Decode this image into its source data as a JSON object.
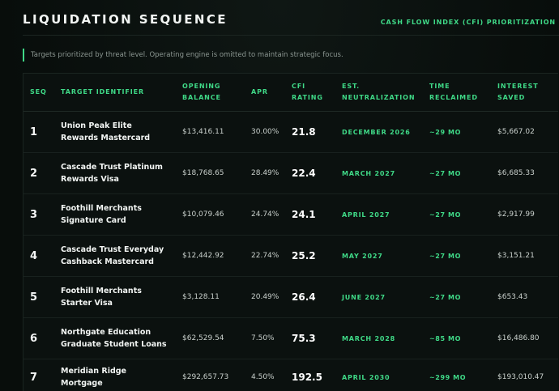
{
  "header": {
    "title": "LIQUIDATION SEQUENCE",
    "subtitle": "CASH FLOW INDEX (CFI) PRIORITIZATION"
  },
  "note": "Targets prioritized by threat level. Operating engine is omitted to maintain strategic focus.",
  "table": {
    "columns": [
      {
        "line1": "SEQ",
        "line2": ""
      },
      {
        "line1": "TARGET IDENTIFIER",
        "line2": ""
      },
      {
        "line1": "OPENING",
        "line2": "BALANCE"
      },
      {
        "line1": "APR",
        "line2": ""
      },
      {
        "line1": "CFI",
        "line2": "RATING"
      },
      {
        "line1": "EST.",
        "line2": "NEUTRALIZATION"
      },
      {
        "line1": "TIME",
        "line2": "RECLAIMED"
      },
      {
        "line1": "INTEREST",
        "line2": "SAVED"
      }
    ],
    "rows": [
      {
        "seq": "1",
        "target": "Union Peak Elite Rewards Mastercard",
        "balance": "$13,416.11",
        "apr": "30.00%",
        "cfi": "21.8",
        "est": "DECEMBER 2026",
        "time": "~29 MO",
        "interest": "$5,667.02"
      },
      {
        "seq": "2",
        "target": "Cascade Trust Platinum Rewards Visa",
        "balance": "$18,768.65",
        "apr": "28.49%",
        "cfi": "22.4",
        "est": "MARCH 2027",
        "time": "~27 MO",
        "interest": "$6,685.33"
      },
      {
        "seq": "3",
        "target": "Foothill Merchants Signature Card",
        "balance": "$10,079.46",
        "apr": "24.74%",
        "cfi": "24.1",
        "est": "APRIL 2027",
        "time": "~27 MO",
        "interest": "$2,917.99"
      },
      {
        "seq": "4",
        "target": "Cascade Trust Everyday Cashback Mastercard",
        "balance": "$12,442.92",
        "apr": "22.74%",
        "cfi": "25.2",
        "est": "MAY 2027",
        "time": "~27 MO",
        "interest": "$3,151.21"
      },
      {
        "seq": "5",
        "target": "Foothill Merchants Starter Visa",
        "balance": "$3,128.11",
        "apr": "20.49%",
        "cfi": "26.4",
        "est": "JUNE 2027",
        "time": "~27 MO",
        "interest": "$653.43"
      },
      {
        "seq": "6",
        "target": "Northgate Education Graduate Student Loans",
        "balance": "$62,529.54",
        "apr": "7.50%",
        "cfi": "75.3",
        "est": "MARCH 2028",
        "time": "~85 MO",
        "interest": "$16,486.80"
      },
      {
        "seq": "7",
        "target": "Meridian Ridge Mortgage",
        "balance": "$292,657.73",
        "apr": "4.50%",
        "cfi": "192.5",
        "est": "APRIL 2030",
        "time": "~299 MO",
        "interest": "$193,010.47"
      }
    ]
  },
  "colors": {
    "accent": "#3fd987",
    "background": "#080d0b",
    "text": "#e6ebe8"
  }
}
